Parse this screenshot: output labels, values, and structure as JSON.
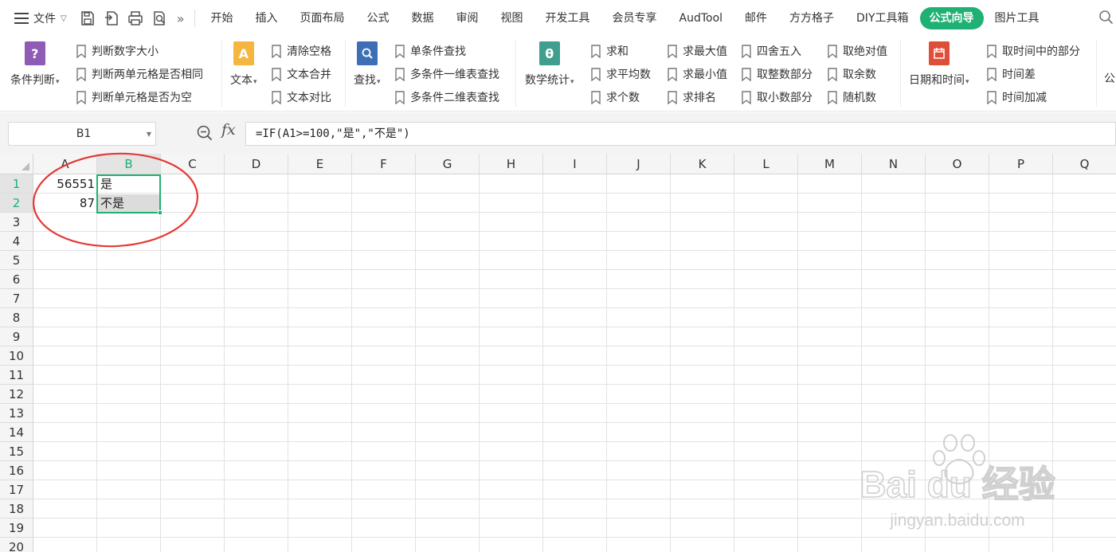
{
  "menubar": {
    "file_label": "文件",
    "tabs": [
      "开始",
      "插入",
      "页面布局",
      "公式",
      "数据",
      "审阅",
      "视图",
      "开发工具",
      "会员专享",
      "AudTool",
      "邮件",
      "方方格子",
      "DIY工具箱",
      "公式向导",
      "图片工具"
    ],
    "active_tab": "公式向导"
  },
  "ribbon": {
    "condition": {
      "label": "条件判断",
      "items": [
        "判断数字大小",
        "判断两单元格是否相同",
        "判断单元格是否为空"
      ]
    },
    "text": {
      "label": "文本",
      "items": [
        "清除空格",
        "文本合并",
        "文本对比"
      ]
    },
    "lookup": {
      "label": "查找",
      "items": [
        "单条件查找",
        "多条件一维表查找",
        "多条件二维表查找"
      ]
    },
    "math": {
      "label": "数学统计",
      "items": [
        "求和",
        "求平均数",
        "求个数",
        "求最大值",
        "求最小值",
        "求排名",
        "四舍五入",
        "取整数部分",
        "取小数部分",
        "取绝对值",
        "取余数",
        "随机数"
      ]
    },
    "datetime": {
      "label": "日期和时间",
      "items": [
        "取时间中的部分",
        "时间差",
        "时间加减"
      ]
    },
    "trailing": "公"
  },
  "formula_bar": {
    "name_box": "B1",
    "fx": "fx",
    "formula": "=IF(A1>=100,\"是\",\"不是\")"
  },
  "sheet": {
    "columns": [
      "A",
      "B",
      "C",
      "D",
      "E",
      "F",
      "G",
      "H",
      "I",
      "J",
      "K",
      "L",
      "M",
      "N",
      "O",
      "P",
      "Q"
    ],
    "rows": [
      "1",
      "2",
      "3",
      "4",
      "5",
      "6",
      "7",
      "8",
      "9",
      "10",
      "11",
      "12",
      "13",
      "14",
      "15",
      "16",
      "17",
      "18",
      "19",
      "20"
    ],
    "cells": {
      "A1": "56551",
      "B1": "是",
      "A2": "87",
      "B2": "不是"
    }
  },
  "watermark": {
    "brand": "Bai du 经验",
    "url": "jingyan.baidu.com"
  },
  "colors": {
    "accent": "#1fb173",
    "annotation": "#e53935"
  }
}
